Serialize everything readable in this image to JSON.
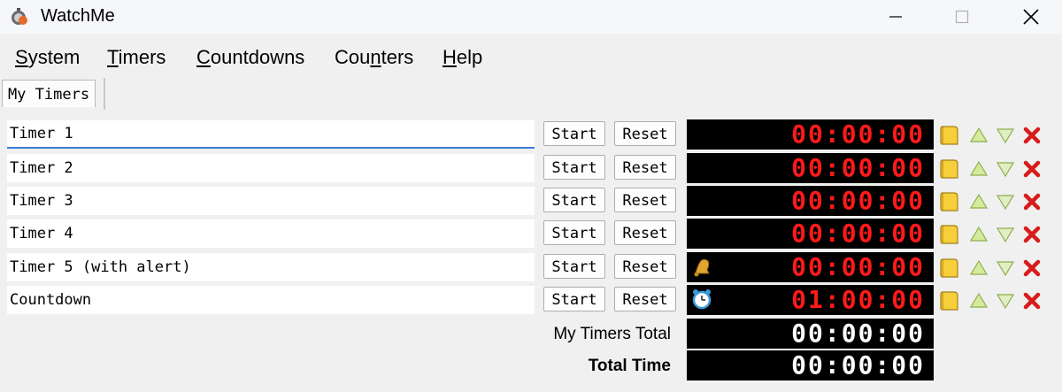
{
  "window": {
    "title": "WatchMe"
  },
  "menu": [
    {
      "label": "System",
      "mnemonic": "S",
      "rest": "ystem"
    },
    {
      "label": "Timers",
      "mnemonic": "T",
      "rest": "imers"
    },
    {
      "label": "Countdowns",
      "mnemonic": "C",
      "rest": "ountdowns"
    },
    {
      "label": "Counters",
      "mnemonic": "Cou",
      "rest": "n",
      "rest2": "ters"
    },
    {
      "label": "Help",
      "mnemonic": "H",
      "rest": "elp"
    }
  ],
  "tabs": [
    {
      "label": "My Timers"
    }
  ],
  "buttons": {
    "start": "Start",
    "reset": "Reset"
  },
  "timers": [
    {
      "name": "Timer 1",
      "time": "00:00:00",
      "alert": null
    },
    {
      "name": "Timer 2",
      "time": "00:00:00",
      "alert": null
    },
    {
      "name": "Timer 3",
      "time": "00:00:00",
      "alert": null
    },
    {
      "name": "Timer 4",
      "time": "00:00:00",
      "alert": null
    },
    {
      "name": "Timer 5 (with alert)",
      "time": "00:00:00",
      "alert": "bell-icon"
    },
    {
      "name": "Countdown",
      "time": "01:00:00",
      "alert": "alarm-clock-icon"
    }
  ],
  "totals": {
    "group_label": "My Timers Total",
    "group_time": "00:00:00",
    "total_label": "Total Time",
    "total_time": "00:00:00"
  },
  "colors": {
    "timer_digits": "#ff1a1a",
    "total_digits": "#ffffff",
    "display_bg": "#000000"
  }
}
